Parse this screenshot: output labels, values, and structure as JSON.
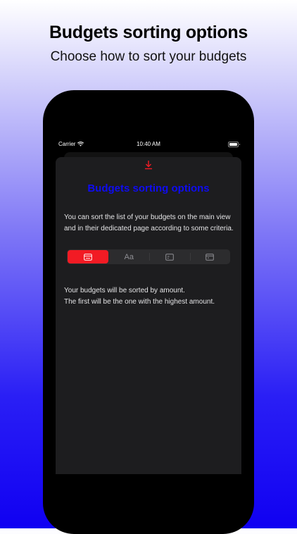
{
  "promo": {
    "title": "Budgets sorting options",
    "subtitle": "Choose how to sort your budgets"
  },
  "status_bar": {
    "carrier": "Carrier",
    "time": "10:40 AM"
  },
  "sheet": {
    "title": "Budgets sorting options",
    "description": "You can sort the list of your budgets on the main view and in their dedicated page according to some criteria.",
    "segments": [
      {
        "icon": "amount-card-icon",
        "label": ""
      },
      {
        "icon": "text-icon",
        "label": "Aa"
      },
      {
        "icon": "calendar-start-icon",
        "label": ""
      },
      {
        "icon": "calendar-end-icon",
        "label": ""
      }
    ],
    "selected_segment": 0,
    "result_line1": "Your budgets will be sorted by amount.",
    "result_line2": "The first will be the one with the highest amount."
  },
  "colors": {
    "accent_red": "#f21b24",
    "title_blue": "#0f0cf0",
    "sheet_bg": "#1d1d1f"
  }
}
